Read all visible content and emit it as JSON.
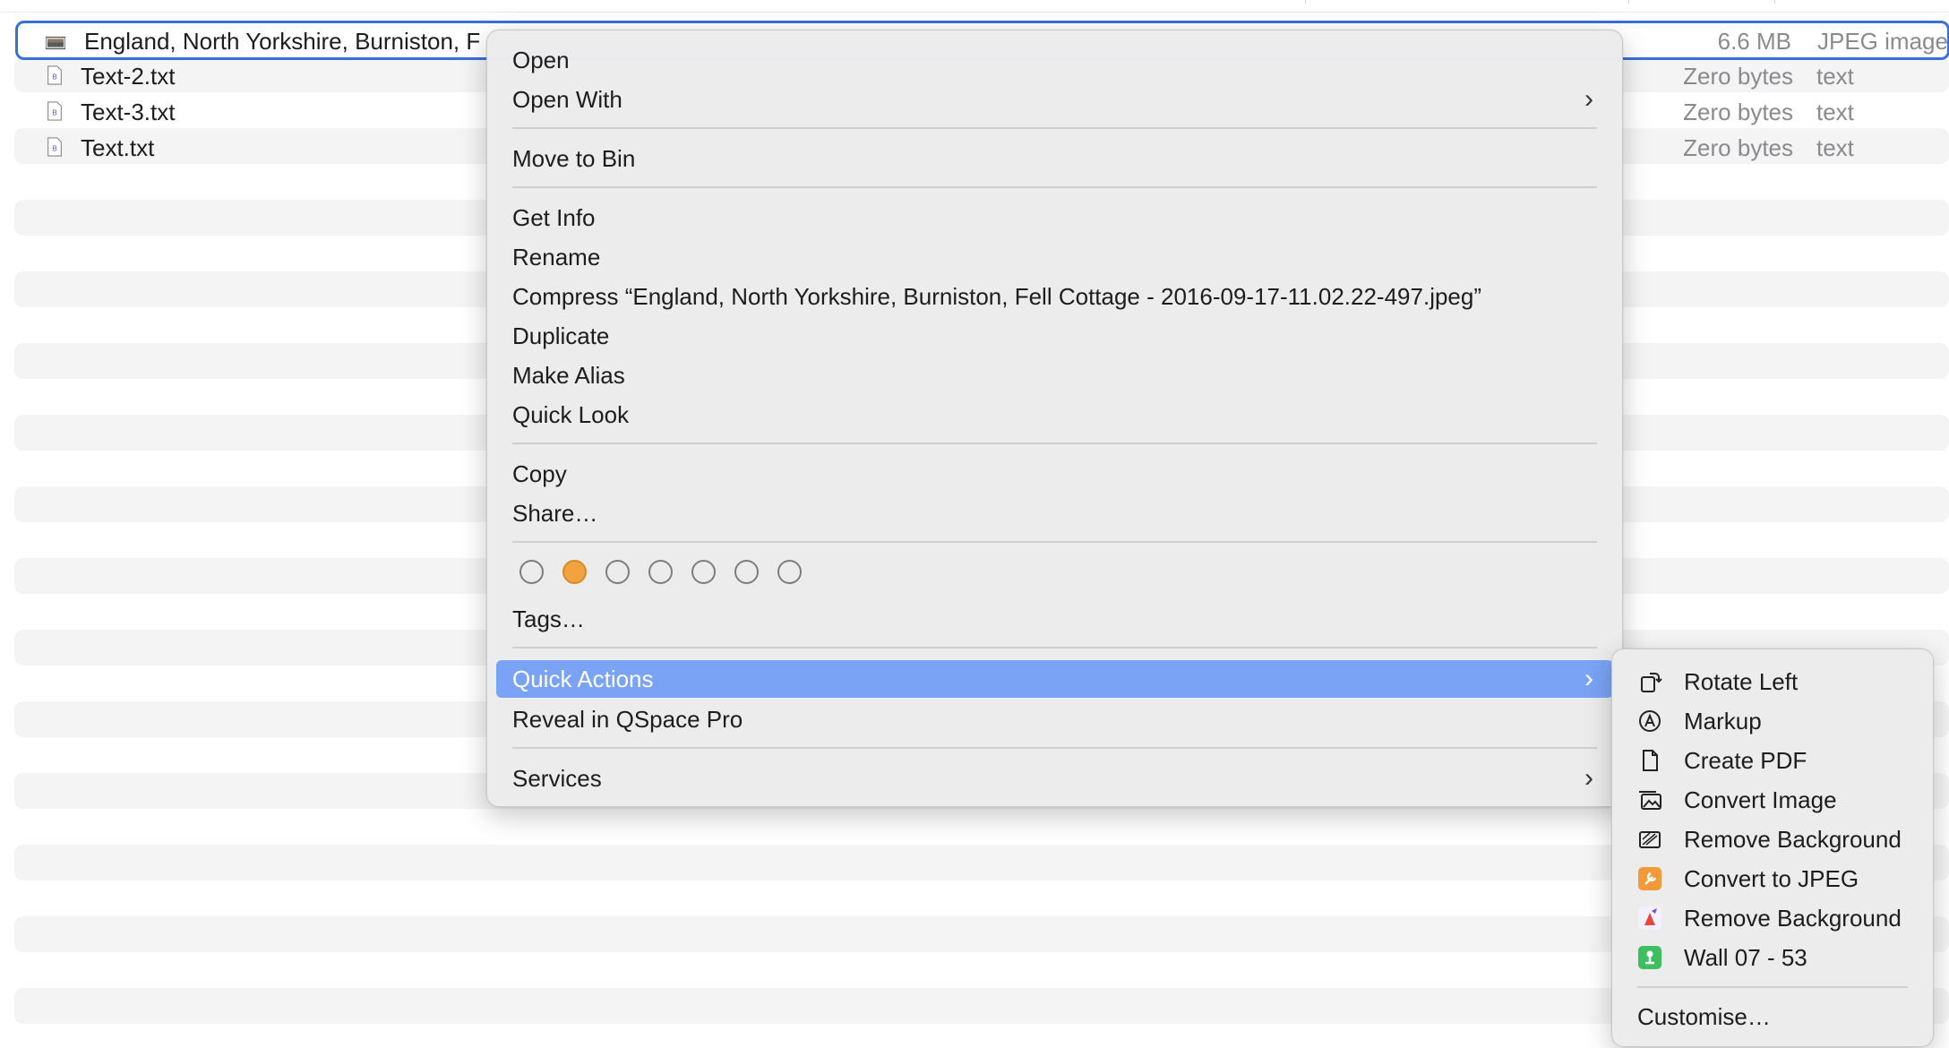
{
  "files": [
    {
      "name": "England, North Yorkshire, Burniston, F",
      "size": "6.6 MB",
      "kind": "JPEG image",
      "selected": true
    },
    {
      "name": "Text-2.txt",
      "size": "Zero bytes",
      "kind": "text"
    },
    {
      "name": "Text-3.txt",
      "size": "Zero bytes",
      "kind": "text"
    },
    {
      "name": "Text.txt",
      "size": "Zero bytes",
      "kind": "text"
    }
  ],
  "context_menu": {
    "open": "Open",
    "open_with": "Open With",
    "move_to_bin": "Move to Bin",
    "get_info": "Get Info",
    "rename": "Rename",
    "compress": "Compress “England, North Yorkshire, Burniston, Fell Cottage - 2016-09-17-11.02.22-497.jpeg”",
    "duplicate": "Duplicate",
    "make_alias": "Make Alias",
    "quick_look": "Quick Look",
    "copy": "Copy",
    "share": "Share…",
    "tags_label": "Tags…",
    "tag_colors": [
      "none",
      "#f0a33f",
      "none",
      "none",
      "none",
      "none",
      "none"
    ],
    "quick_actions": "Quick Actions",
    "reveal": "Reveal in QSpace Pro",
    "services": "Services"
  },
  "quick_actions_submenu": {
    "items": [
      {
        "label": "Rotate Left",
        "icon": "rotate-left-icon"
      },
      {
        "label": "Markup",
        "icon": "markup-icon"
      },
      {
        "label": "Create PDF",
        "icon": "document-icon"
      },
      {
        "label": "Convert Image",
        "icon": "photos-icon"
      },
      {
        "label": "Remove Background",
        "icon": "remove-background-icon"
      },
      {
        "label": "Convert to JPEG",
        "icon": "automator-icon"
      },
      {
        "label": "Remove Background",
        "icon": "remove-background-app-icon"
      },
      {
        "label": "Wall 07 - 53",
        "icon": "green-app-icon"
      }
    ],
    "customise": "Customise…"
  },
  "colors": {
    "selection_border": "#3a6fd8",
    "highlight": "#7aa3f5",
    "orange_tag": "#f0a33f"
  }
}
